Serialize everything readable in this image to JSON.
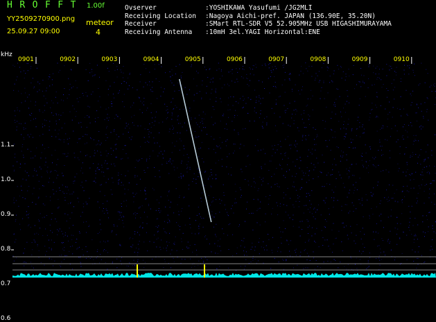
{
  "header": {
    "app_name": "HROFFT",
    "version": "1.00f",
    "file_name": "YY2509270900.png",
    "datetime": "25.09.27 09:00",
    "meteor_label": "meteor",
    "meteor_count": "4"
  },
  "info": [
    {
      "label": "Ovserver",
      "value": ":YOSHIKAWA Yasufumi /JG2MLI"
    },
    {
      "label": "Receiving Location",
      "value": ":Nagoya Aichi-pref. JAPAN (136.90E, 35.20N)"
    },
    {
      "label": "Receiver",
      "value": ":SMart RTL-SDR V5 52.905MHz USB HIGASHIMURAYAMA"
    },
    {
      "label": "Receiving Antenna",
      "value": ":10mH 3el.YAGI Horizontal:ENE"
    }
  ],
  "spectrogram": {
    "unit_label": "kHz",
    "time_ticks": [
      "0901",
      "0902",
      "0903",
      "0904",
      "0905",
      "0906",
      "0907",
      "0908",
      "0909",
      "0910"
    ],
    "freq_ticks": [
      "1.1",
      "1.0",
      "0.9",
      "0.8",
      "0.7",
      "0.6"
    ],
    "meteor_echo": {
      "start_time": "0905",
      "start_khz": 1.2,
      "end_khz": 0.88
    }
  },
  "colors": {
    "background": "#000000",
    "title_green": "#66ff33",
    "header_yellow": "#ffff00",
    "info_white": "#ffffff",
    "noise_blue": "#1c1cc8",
    "echo_cyan": "#d8f0ff",
    "level_cyan": "#00ffff",
    "ref_line": "#ffffff"
  }
}
